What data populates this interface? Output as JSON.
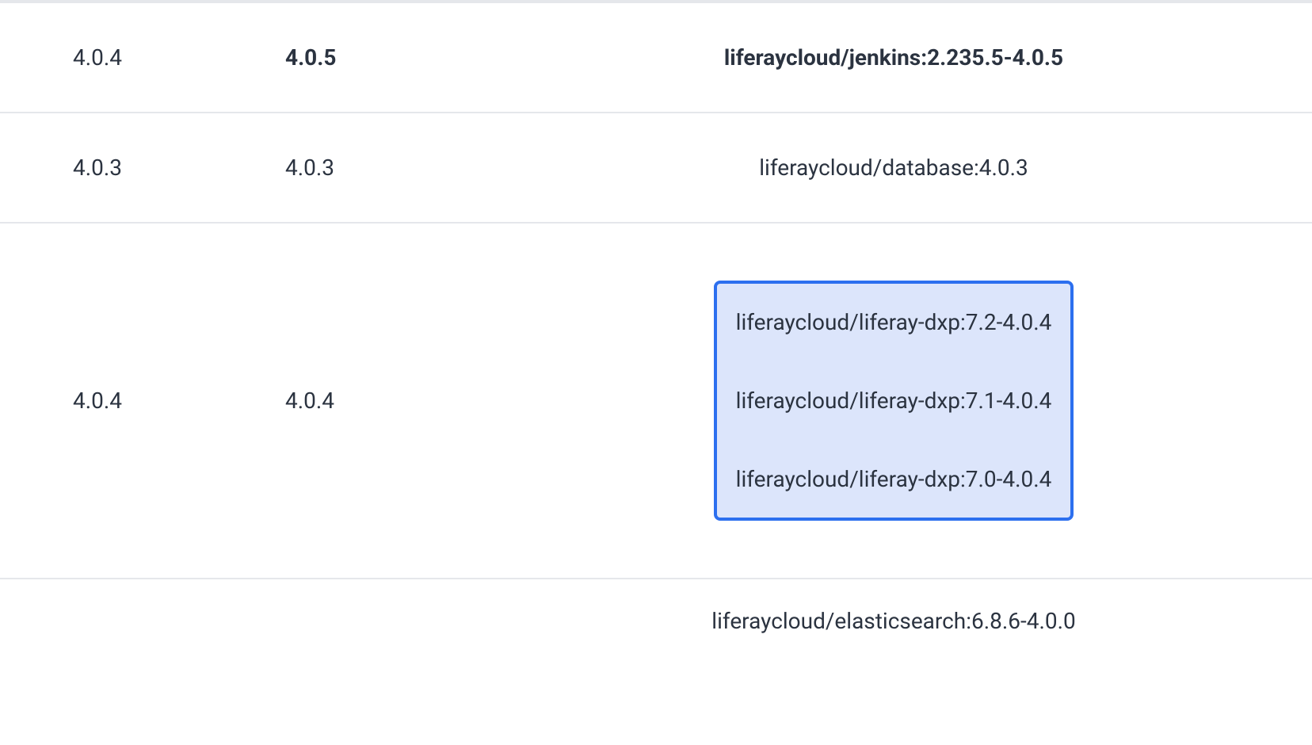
{
  "rows": [
    {
      "col1": "4.0.4",
      "col2": "4.0.5",
      "col3": "liferaycloud/jenkins:2.235.5-4.0.5",
      "bold": true
    },
    {
      "col1": "4.0.3",
      "col2": "4.0.3",
      "col3": "liferaycloud/database:4.0.3",
      "bold": false
    },
    {
      "col1": "4.0.4",
      "col2": "4.0.4",
      "highlighted": true,
      "lines": [
        "liferaycloud/liferay-dxp:7.2-4.0.4",
        "liferaycloud/liferay-dxp:7.1-4.0.4",
        "liferaycloud/liferay-dxp:7.0-4.0.4"
      ]
    },
    {
      "col1": "",
      "col2": "",
      "col3": "liferaycloud/elasticsearch:6.8.6-4.0.0",
      "partial": true
    }
  ]
}
